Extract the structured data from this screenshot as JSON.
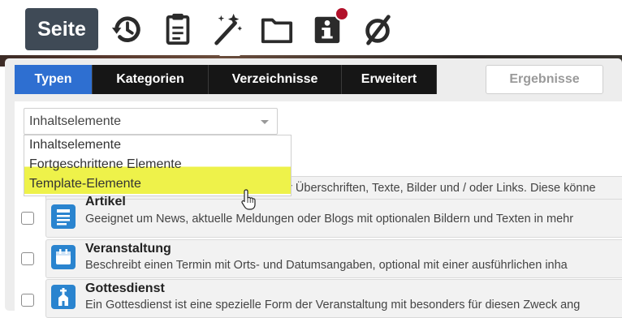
{
  "toolbar": {
    "page_button": "Seite",
    "icons": [
      "history-icon",
      "clipboard-icon",
      "magic-wand-icon",
      "folder-icon",
      "info-icon",
      "empty-set-icon"
    ],
    "notification_color": "#b2102a"
  },
  "tabs": [
    {
      "label": "Typen",
      "active": true
    },
    {
      "label": "Kategorien",
      "active": false
    },
    {
      "label": "Verzeichnisse",
      "active": false
    },
    {
      "label": "Erweitert",
      "active": false
    }
  ],
  "results_button": "Ergebnisse",
  "select": {
    "value": "Inhaltselemente",
    "options": [
      "Inhaltselemente",
      "Fortgeschrittene Elemente",
      "Template-Elemente"
    ],
    "highlighted_option": "Template-Elemente"
  },
  "list": {
    "partial_text": "ür Überschriften, Texte, Bilder und / oder Links. Diese könne",
    "items": [
      {
        "title": "Artikel",
        "description": "Geeignet um News, aktuelle Meldungen oder Blogs mit optionalen Bildern und Texten in mehr",
        "icon": "article-icon"
      },
      {
        "title": "Veranstaltung",
        "description": "Beschreibt einen Termin mit Orts- und Datumsangaben, optional mit einer ausführlichen inha",
        "icon": "calendar-icon"
      },
      {
        "title": "Gottesdienst",
        "description": "Ein Gottesdienst ist eine spezielle Form der Veranstaltung mit besonders für diesen Zweck ang",
        "icon": "church-icon"
      }
    ]
  },
  "colors": {
    "active_tab": "#2e6fd1",
    "tab_bar": "#161616",
    "highlight": "#eef24a",
    "icon_blue": "#2a84cf",
    "page_button_bg": "#3f4a56"
  }
}
